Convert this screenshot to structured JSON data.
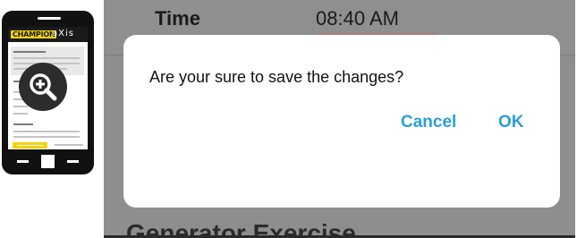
{
  "phone_illustration": {
    "brand_logo": "CHAMPION",
    "product_logo": "aXis",
    "icons": [
      "magnify-plus-icon"
    ]
  },
  "app": {
    "time_label": "Time",
    "time_value": "08:40 AM",
    "section_title": "Generator Exercise"
  },
  "dialog": {
    "message": "Are your sure to save the changes?",
    "cancel_label": "Cancel",
    "ok_label": "OK",
    "accent_color": "#2a9fd8"
  },
  "colors": {
    "overlay": "#8e8e8e",
    "brand_yellow": "#f5d20a"
  }
}
